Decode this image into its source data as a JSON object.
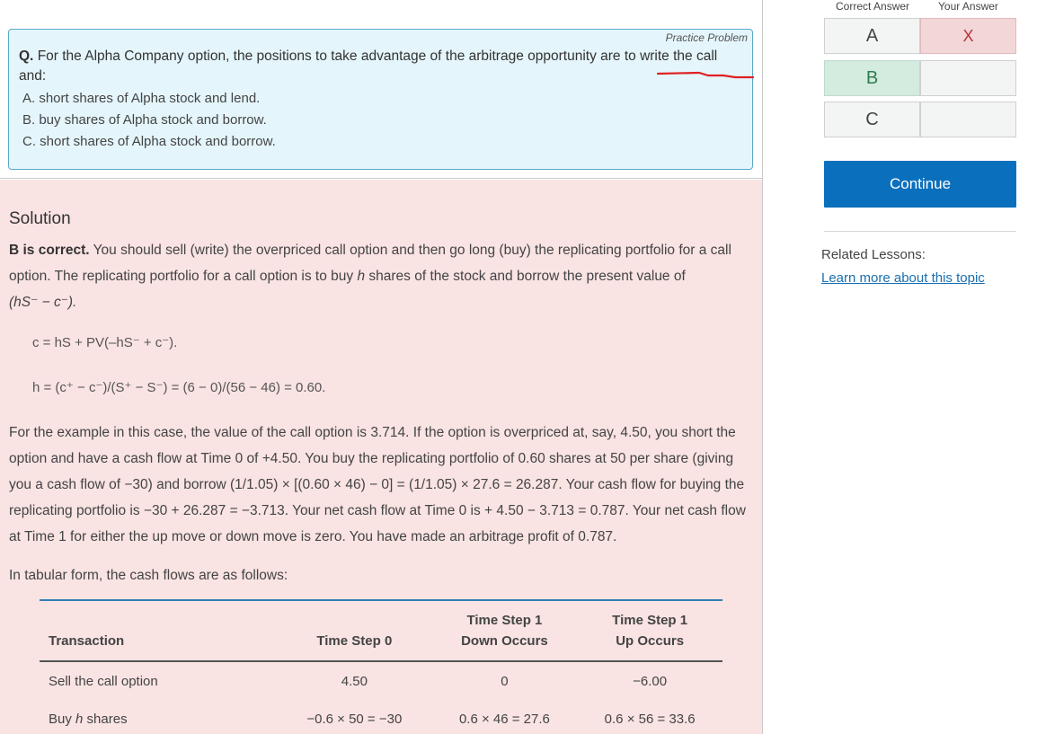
{
  "question": {
    "label": "Practice Problem",
    "prefix": "Q.",
    "text": "For the Alpha Company option, the positions to take advantage of the arbitrage opportunity are to write the call and:",
    "choices": [
      "A. short shares of Alpha stock and lend.",
      "B. buy shares of Alpha stock and borrow.",
      "C. short shares of Alpha stock and borrow."
    ]
  },
  "solution": {
    "title": "Solution",
    "correct_lead": "B is correct.",
    "p1_a": "You should sell (write) the overpriced call option and then go long (buy) the replicating portfolio for a call option. The replicating portfolio for a call option is to buy",
    "p1_h": "h",
    "p1_b": "shares of the stock and borrow the present value of",
    "p1_c": "(hS⁻ − c⁻).",
    "eq1": "c = hS + PV(–hS⁻ + c⁻).",
    "eq2": "h = (c⁺ − c⁻)/(S⁺ − S⁻) = (6 − 0)/(56 − 46) = 0.60.",
    "p2": "For the example in this case, the value of the call option is 3.714. If the option is overpriced at, say, 4.50, you short the option and have a cash flow at Time 0 of +4.50. You buy the replicating portfolio of 0.60 shares at 50 per share (giving you a cash flow of −30) and borrow (1/1.05) × [(0.60 × 46) − 0] = (1/1.05) × 27.6 = 26.287. Your cash flow for buying the replicating portfolio is −30 + 26.287 = −3.713. Your net cash flow at Time 0 is + 4.50 − 3.713 = 0.787. Your net cash flow at Time 1 for either the up move or down move is zero. You have made an arbitrage profit of 0.787.",
    "p3": "In tabular form, the cash flows are as follows:",
    "table": {
      "headers": [
        "Transaction",
        "Time Step 0",
        "Time Step 1 Down Occurs",
        "Time Step 1 Up Occurs"
      ],
      "header_lines": {
        "c3_l1": "Time Step 1",
        "c3_l2": "Down Occurs",
        "c4_l1": "Time Step 1",
        "c4_l2": "Up Occurs"
      },
      "rows": [
        {
          "transaction": "Sell the call option",
          "t0": "4.50",
          "down": "0",
          "up": "−6.00"
        },
        {
          "transaction_pre": "Buy",
          "transaction_h": "h",
          "transaction_post": "shares",
          "t0": "−0.6 × 50 = −30",
          "down": "0.6 × 46 = 27.6",
          "up": "0.6 × 56 = 33.6"
        }
      ]
    }
  },
  "answers": {
    "correct_header": "Correct Answer",
    "yours_header": "Your Answer",
    "rows": [
      {
        "letter": "A",
        "mark": "X"
      },
      {
        "letter": "B",
        "mark": ""
      },
      {
        "letter": "C",
        "mark": ""
      }
    ]
  },
  "continue_label": "Continue",
  "related_label": "Related Lessons:",
  "learn_link": "Learn more about this topic",
  "colors": {
    "primary_button": "#0a70bd",
    "question_bg": "#e4f5fb",
    "solution_bg": "#f9e3e3",
    "correct_cell": "#d4ebe0",
    "wrong_cell": "#f3d6d8"
  }
}
